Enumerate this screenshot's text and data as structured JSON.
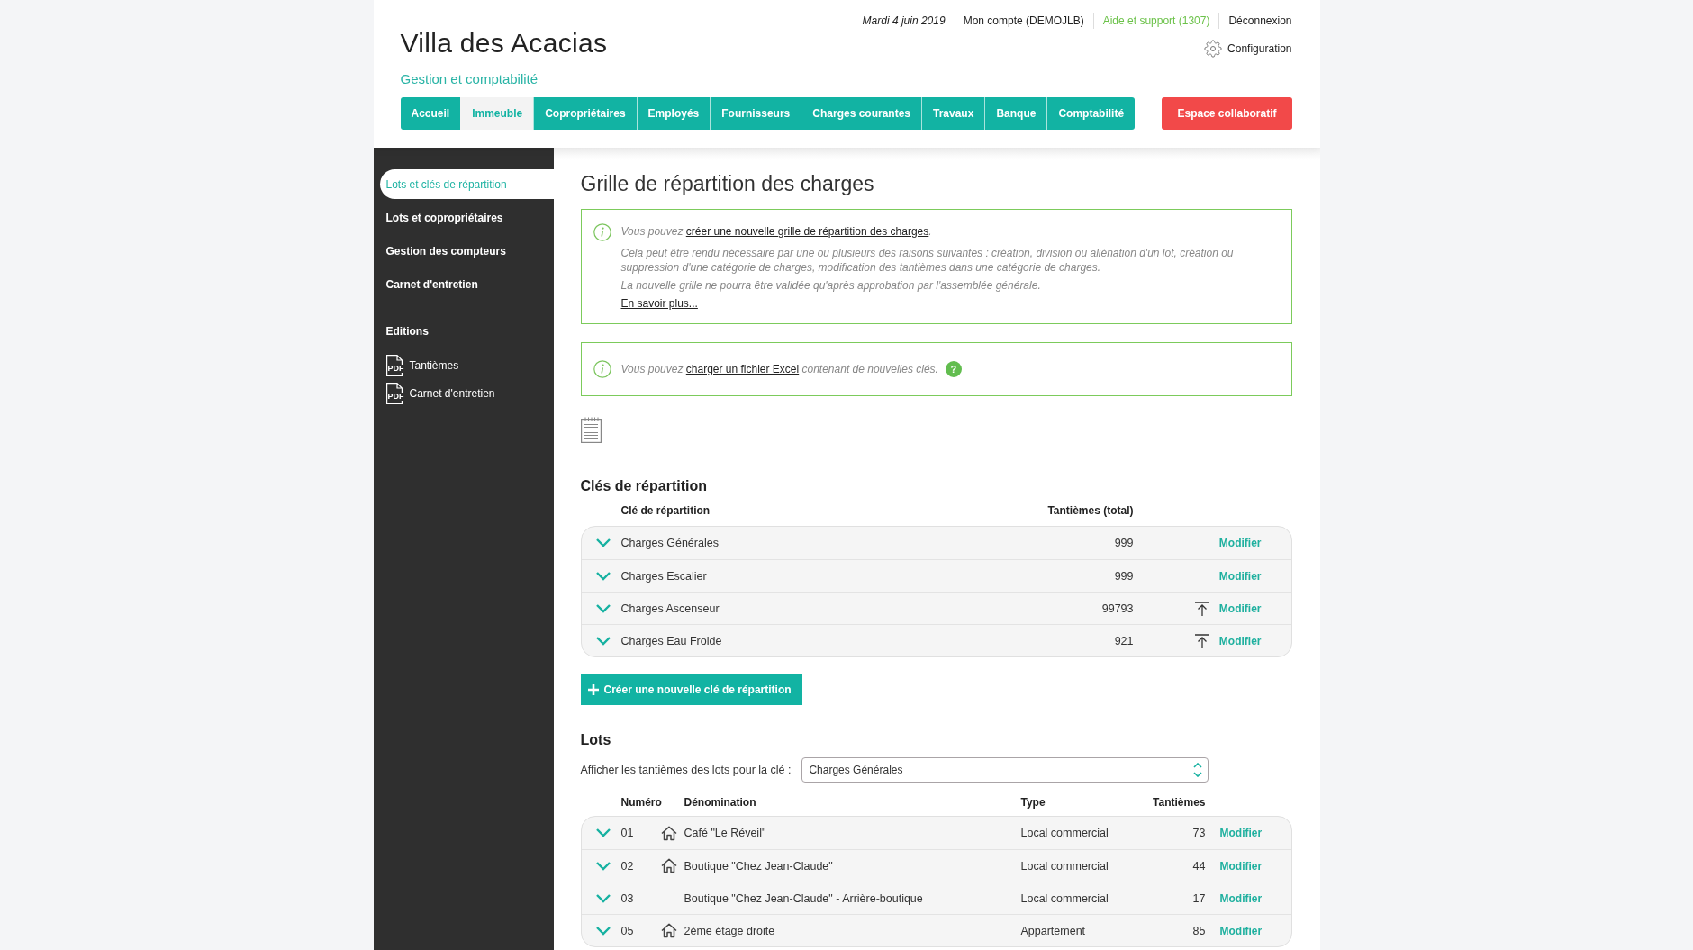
{
  "header": {
    "title": "Villa des Acacias",
    "subtitle": "Gestion et comptabilité",
    "date": "Mardi 4 juin 2019",
    "links": [
      {
        "label": "Mon compte (DEMOJLB)",
        "kind": "account"
      },
      {
        "label": "Aide et support (1307)",
        "kind": "support"
      },
      {
        "label": "Déconnexion",
        "kind": "logout"
      }
    ],
    "settings": "Configuration"
  },
  "nav": {
    "tabs": [
      {
        "label": "Accueil",
        "selected": false
      },
      {
        "label": "Immeuble",
        "selected": true
      },
      {
        "label": "Copropriétaires",
        "selected": false
      },
      {
        "label": "Employés",
        "selected": false
      },
      {
        "label": "Fournisseurs",
        "selected": false
      },
      {
        "label": "Charges courantes",
        "selected": false
      },
      {
        "label": "Travaux",
        "selected": false
      },
      {
        "label": "Banque",
        "selected": false
      },
      {
        "label": "Comptabilité",
        "selected": false
      }
    ],
    "action": "Espace collaboratif"
  },
  "sidebar": {
    "items": [
      {
        "label": "Lots et clés de répartition",
        "selected": true
      },
      {
        "label": "Lots et copropriétaires",
        "selected": false
      },
      {
        "label": "Gestion des compteurs",
        "selected": false
      },
      {
        "label": "Carnet d'entretien",
        "selected": false
      }
    ],
    "section": "Editions",
    "documents": [
      {
        "label": "Tantièmes",
        "format": "PDF"
      },
      {
        "label": "Carnet d'entretien",
        "format": "PDF"
      }
    ]
  },
  "page": {
    "title": "Grille de répartition des charges",
    "notices": [
      {
        "before": "Vous pouvez ",
        "link": "créer une nouvelle grille de répartition des charges",
        "after": ".",
        "details": [
          "Cela peut être rendu nécessaire par une ou plusieurs des raisons suivantes : création, division ou aliénation d'un lot, création ou suppression d'une catégorie de charges, modification des tantièmes dans une catégorie de charges.",
          "La nouvelle grille ne pourra être validée qu'après approbation par l'assemblée générale."
        ],
        "more": "En savoir plus..."
      },
      {
        "before": "Vous pouvez ",
        "link": "charger un fichier Excel",
        "after": " contenant de nouvelles clés.",
        "help": "?"
      }
    ]
  },
  "keys": {
    "title": "Clés de répartition",
    "columns": [
      "Clé de répartition",
      "Tantièmes (total)"
    ],
    "rows": [
      {
        "name": "Charges Générales",
        "total": "999",
        "upload": false,
        "expanded": false,
        "action": "Modifier"
      },
      {
        "name": "Charges Escalier",
        "total": "999",
        "upload": false,
        "expanded": false,
        "action": "Modifier"
      },
      {
        "name": "Charges Ascenseur",
        "total": "99793",
        "upload": true,
        "expanded": false,
        "action": "Modifier"
      },
      {
        "name": "Charges Eau Froide",
        "total": "921",
        "upload": true,
        "expanded": false,
        "action": "Modifier"
      }
    ],
    "create": "Créer une nouvelle clé de répartition"
  },
  "lots": {
    "title": "Lots",
    "filter_label": "Afficher les tantièmes des lots pour la clé :",
    "filter_value": "Charges Générales",
    "columns": [
      "Numéro",
      "Dénomination",
      "Type",
      "Tantièmes"
    ],
    "rows": [
      {
        "number": "01",
        "icon": true,
        "name": "Café \"Le Réveil\"",
        "type": "Local commercial",
        "share": "73",
        "expanded": false,
        "action": "Modifier"
      },
      {
        "number": "02",
        "icon": true,
        "name": "Boutique \"Chez Jean-Claude\"",
        "type": "Local commercial",
        "share": "44",
        "expanded": false,
        "action": "Modifier"
      },
      {
        "number": "03",
        "icon": false,
        "name": "Boutique \"Chez Jean-Claude\" - Arrière-boutique",
        "type": "Local commercial",
        "share": "17",
        "expanded": false,
        "action": "Modifier"
      },
      {
        "number": "05",
        "icon": true,
        "name": "2ème étage droite",
        "type": "Appartement",
        "share": "85",
        "expanded": false,
        "action": "Modifier"
      }
    ]
  }
}
